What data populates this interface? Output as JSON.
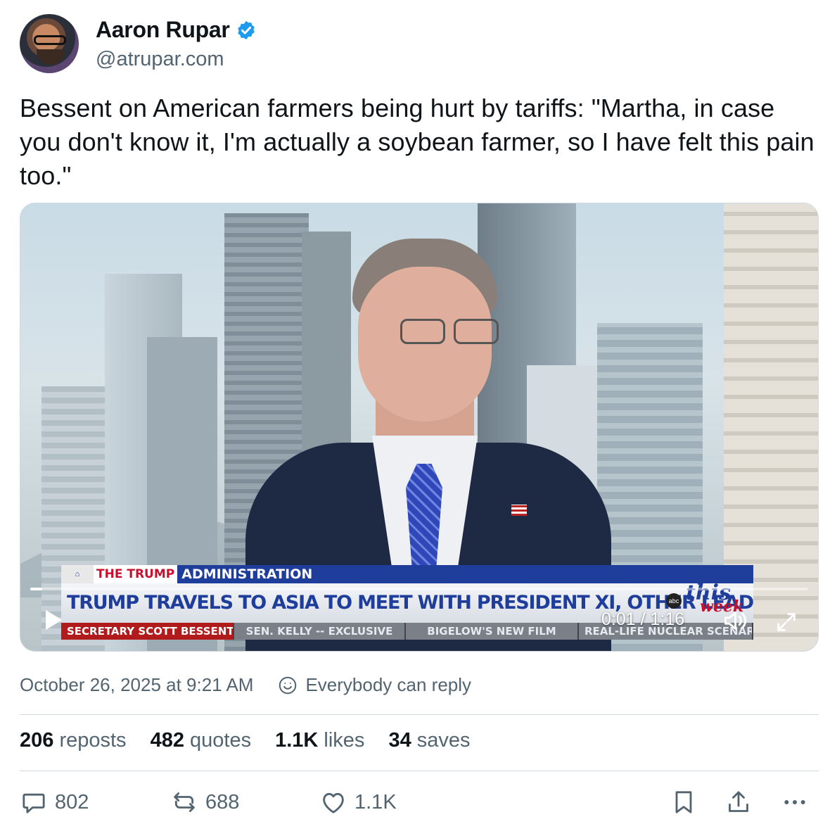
{
  "author": {
    "name": "Aaron Rupar",
    "handle": "@atrupar.com"
  },
  "post": {
    "text": "Bessent on American farmers being hurt by tariffs: \"Martha, in case you don't know it, I'm actually a soybean farmer, so I have felt this pain too.\""
  },
  "video": {
    "chyron_the": "THE",
    "chyron_trump": "TRUMP",
    "chyron_admin": "ADMINISTRATION",
    "headline": "TRUMP TRAVELS TO ASIA TO MEET WITH PRESIDENT XI, OTHER LEADERS",
    "ticker": [
      "SECRETARY SCOTT BESSENT",
      "SEN. KELLY -- EXCLUSIVE",
      "BIGELOW'S NEW FILM",
      "REAL-LIFE NUCLEAR SCENARIO"
    ],
    "logo_network": "abc",
    "logo_this": "this",
    "logo_week": "week",
    "time_display": "0:01 / 1:16",
    "progress": 0.01
  },
  "meta": {
    "timestamp": "October 26, 2025 at 9:21 AM",
    "reply_setting": "Everybody can reply"
  },
  "stats": {
    "reposts_num": "206",
    "reposts_label": "reposts",
    "quotes_num": "482",
    "quotes_label": "quotes",
    "likes_num": "1.1K",
    "likes_label": "likes",
    "saves_num": "34",
    "saves_label": "saves"
  },
  "actions": {
    "reply_count": "802",
    "repost_count": "688",
    "like_count": "1.1K"
  },
  "icons": [
    "verified-badge-icon",
    "reply-setting-icon",
    "play-icon",
    "volume-icon",
    "fullscreen-icon",
    "reply-icon",
    "repost-icon",
    "like-icon",
    "bookmark-icon",
    "share-icon",
    "more-icon"
  ],
  "colors": {
    "accent": "#1d9bf0",
    "muted": "#536471",
    "text": "#0f1419"
  }
}
